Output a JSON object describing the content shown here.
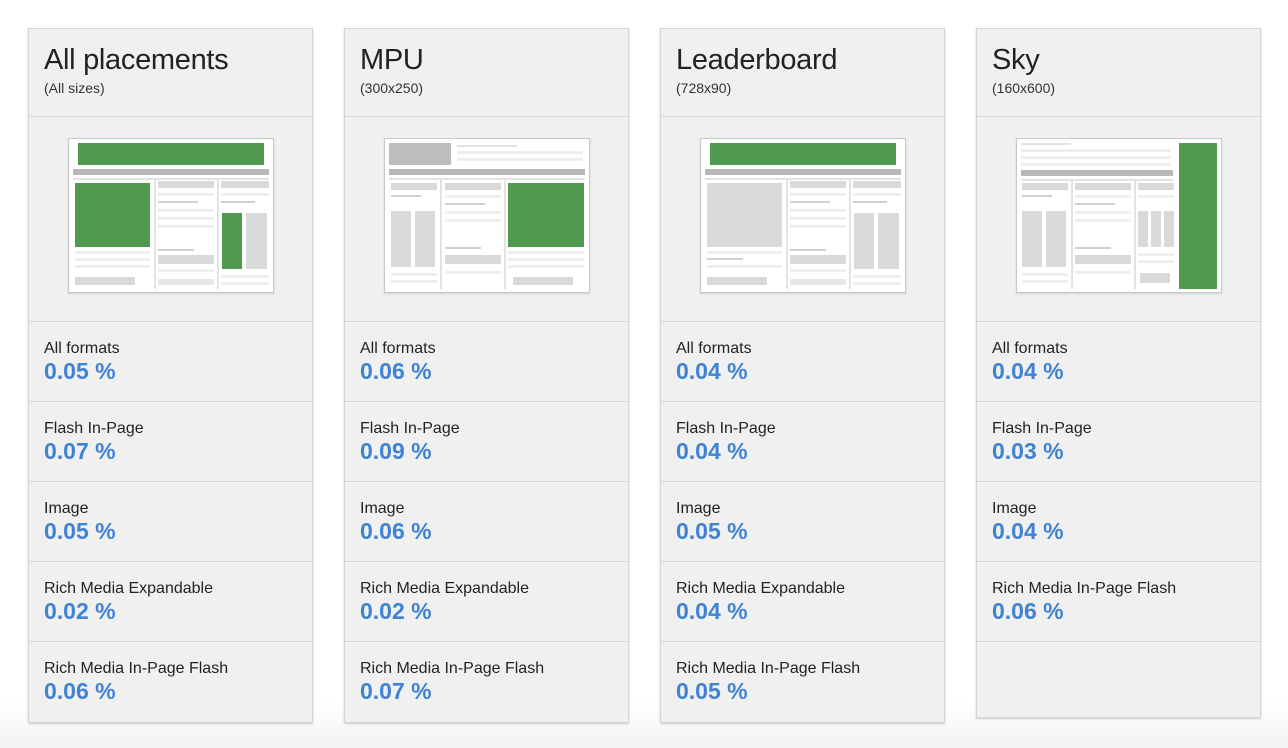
{
  "colors": {
    "accent": "#3f83d2",
    "ad_highlight": "#4f9a4f",
    "card_bg": "#f0f0f0"
  },
  "cards": [
    {
      "title": "All placements",
      "subtitle": "(All sizes)",
      "metrics": [
        {
          "label": "All formats",
          "value": "0.05 %"
        },
        {
          "label": "Flash In-Page",
          "value": "0.07 %"
        },
        {
          "label": "Image",
          "value": "0.05 %"
        },
        {
          "label": "Rich Media Expandable",
          "value": "0.02 %"
        },
        {
          "label": "Rich Media In-Page Flash",
          "value": "0.06 %"
        }
      ]
    },
    {
      "title": "MPU",
      "subtitle": "(300x250)",
      "metrics": [
        {
          "label": "All formats",
          "value": "0.06 %"
        },
        {
          "label": "Flash In-Page",
          "value": "0.09 %"
        },
        {
          "label": "Image",
          "value": "0.06 %"
        },
        {
          "label": "Rich Media Expandable",
          "value": "0.02 %"
        },
        {
          "label": "Rich Media In-Page Flash",
          "value": "0.07 %"
        }
      ]
    },
    {
      "title": "Leaderboard",
      "subtitle": "(728x90)",
      "metrics": [
        {
          "label": "All formats",
          "value": "0.04 %"
        },
        {
          "label": "Flash In-Page",
          "value": "0.04 %"
        },
        {
          "label": "Image",
          "value": "0.05 %"
        },
        {
          "label": "Rich Media Expandable",
          "value": "0.04 %"
        },
        {
          "label": "Rich Media In-Page Flash",
          "value": "0.05 %"
        }
      ]
    },
    {
      "title": "Sky",
      "subtitle": "(160x600)",
      "metrics": [
        {
          "label": "All formats",
          "value": "0.04 %"
        },
        {
          "label": "Flash In-Page",
          "value": "0.03 %"
        },
        {
          "label": "Image",
          "value": "0.04 %"
        },
        {
          "label": "Rich Media In-Page Flash",
          "value": "0.06 %"
        }
      ]
    }
  ]
}
